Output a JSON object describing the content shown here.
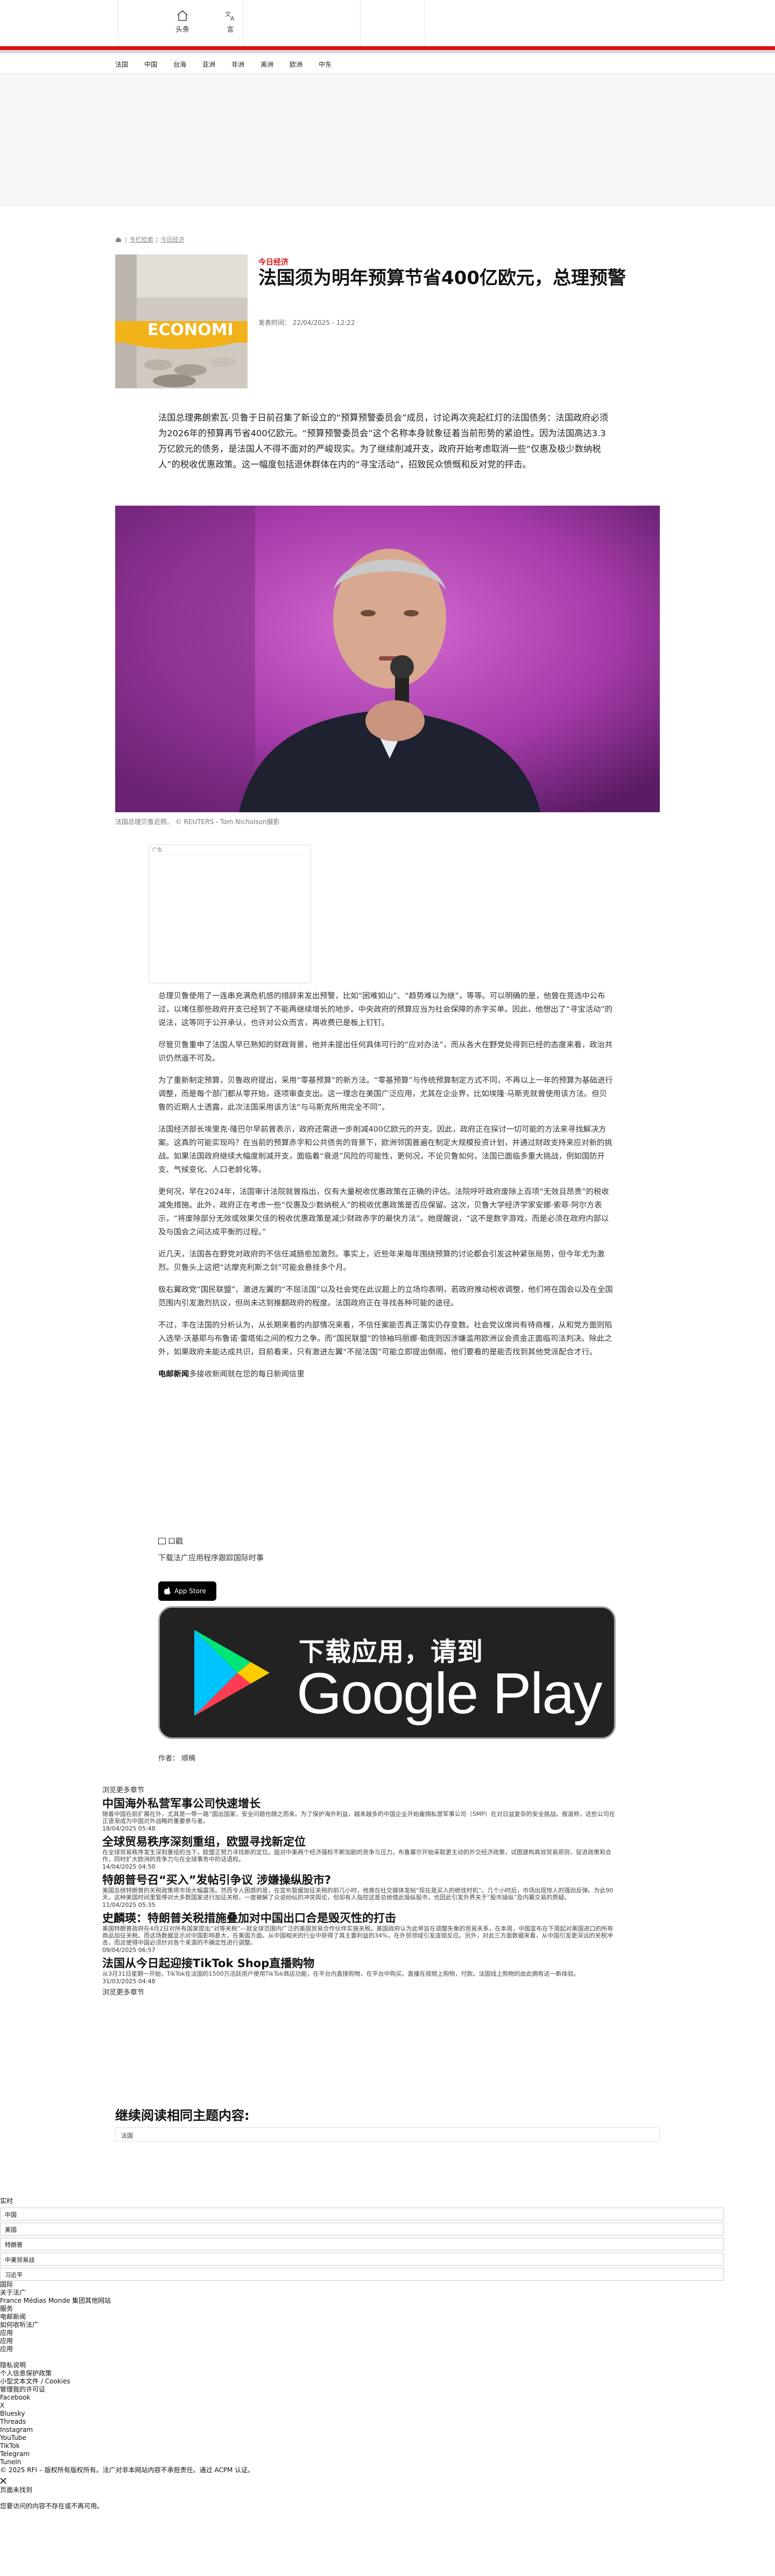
{
  "header": {
    "tabs": [
      {
        "label": "头条",
        "icon": "home-icon"
      },
      {
        "label": "言",
        "icon": "translate-icon"
      }
    ]
  },
  "nav": {
    "items": [
      "法国",
      "中国",
      "台海",
      "亚洲",
      "非洲",
      "美洲",
      "欧洲",
      "中东"
    ]
  },
  "breadcrumb": {
    "items": [
      "专栏检索",
      "今日经济"
    ]
  },
  "article": {
    "kicker": "今日经济",
    "title": "法国须为明年预算节省400亿欧元，总理预警",
    "date": "发表时间： 22/04/2025 - 12:22",
    "thumb_text": "ECONOMI",
    "lead": "法国总理弗朗索瓦·贝鲁于日前召集了新设立的“预算预警委员会”成员，讨论再次亮起红灯的法国债务：法国政府必须为2026年的预算再节省400亿欧元。“预算预警委员会”这个名称本身就象征着当前形势的紧迫性。因为法国高达3.3万亿欧元的债务，是法国人不得不面对的严峻现实。为了继续削减开支，政府开始考虑取消一些“仅惠及极少数纳税人”的税收优惠政策。这一幅度包括退休群体在内的“寻宝活动”，招致民众愤慨和反对党的抨击。",
    "caption": "法国总理贝鲁近照。 © REUTERS - Tom Nicholson摄影",
    "ad_label": "广告",
    "paragraphs": [
      "总理贝鲁使用了一连串充满危机感的措辞来发出预警，比如“困难如山”、“趋势难以为继”，等等。可以明确的是，他曾在竞选中公布过，以堵住那些政府开支已经到了不能再继续增长的地步。中央政府的预算应当为社会保障的赤字买单。因此，他想出了“寻宝活动”的说法，这等同于公开承认，也许对公众而言，再收费已是板上钉钉。",
      "尽管贝鲁重申了法国人早已熟知的财政背景，他并未提出任何具体可行的“应对办法”，而从各大在野党处得到已经的态度来看，政治共识仍然遥不可及。",
      "为了重新制定预算，贝鲁政府提出，采用“零基预算”的新方法。“零基预算”与传统预算制定方式不同，不再以上一年的预算为基础进行调整，而是每个部门都从零开始，逐项审查支出。这一理念在美国广泛应用，尤其在企业界，比如埃隆·马斯克就曾使用该方法。但贝鲁的近期人士透露，此次法国采用该方法“与马斯克所用完全不同”。",
      "法国经济部长埃里克·隆巴尔早前曾表示，政府还需进一步削减400亿欧元的开支。因此，政府正在探讨一切可能的方法来寻找解决方案。这真的可能实现吗？在当前的预算赤字和公共债务的背景下，欧洲邻国普遍在制定大规模投资计划，并通过财政支持来应对新的挑战。如果法国政府继续大幅度削减开支，面临着“衰退”风险的可能性，更何况，不论贝鲁如何，法国已面临多重大挑战，例如国防开支、气候变化、人口老龄化等。",
      "更何况，早在2024年，法国审计法院就曾指出，仅有大量税收优惠政策在正确的评估。法院呼吁政府废除上百项“无效且昂贵”的税收减免措施。此外，政府正在考虑一些“仅惠及少数纳税人”的税收优惠政策是否应保留。这次，贝鲁大学经济学家安娜·索菲·阿尔方表示，“将废除部分无效或效果欠佳的税收优惠政策是减少财政赤字的最快方法”。她提醒说，“这不是数字游戏，而是必须在政府内部以及与国会之间达成平衡的过程。”",
      "近几天，法国各在野党对政府的不信任减肠愈加激烈。事实上，近些年来每年围绕预算的讨论都会引发这种紧张局势，但今年尤为激烈。贝鲁头上这把“达摩克利斯之剑”可能会悬挂多个月。",
      "极右翼政党“国民联盟”、激进左翼的“不屈法国”以及社会党在此议题上的立场均表明，若政府推动税收调整，他们将在国会以及在全国范围内引发激烈抗议，但尚未达到推翻政府的程度。法国政府正在寻找各种可能的途径。",
      "不过，丰在法国的分析认为，从长期来看的内部情况来看，不信任案能否真正落实仍存变数。社会党议席尚有待商榷，从和党方面则陷入选举·沃基耶与布鲁诺·雷塔佑之间的权力之争。而“国民联盟”的领袖玛丽娜·勒庞则因涉嫌滥用欧洲议会资金正面临司法判决。除此之外，如果政府未能达成共识，目前看来，只有激进左翼“不屈法国”可能立即提出倒阁，他们要看的是能否找到其他党派配合才行。"
    ],
    "newsletter_bold": "电邮新闻",
    "newsletter_text": "多接收新闻就在您的每日新闻信里",
    "share_label": "口戳",
    "download_line": "下载法广应用程序跟踪国际时事",
    "appstore": "App Store",
    "gplay_line1": "下载应用，请到",
    "gplay_line2": "Google Play",
    "author": "作者： 顺楠"
  },
  "related": {
    "header": "浏览更多章节",
    "items": [
      {
        "title": "中国海外私营军事公司快速增长",
        "desc": "随着中国在前扩展在外，尤其是一带一路“国出国家，安全问题也随之而来。为了保护海外利益，越来越多的中国企业开始雇佣私营军事公司（SMP）在对日益复杂的安全挑战。报道称，这些公司在正逐渐成为中国对外战略的重要参与者。",
        "date": "18/04/2025 05:48"
      },
      {
        "title": "全球贸易秩序深刻重组，欧盟寻找新定位",
        "desc": "在全球贸易秩序发生深刻重组的当下，欧盟正努力寻找新的定位。面对中美两个经济强权不断加剧的竞争与压力，布鲁塞尔开始采取更主动的外交经济政策，试图建构高效贸易原则，促进政策和合作，同时扩大欧洲的竞争力与在全球事务中的话语权。",
        "date": "14/04/2025 04:50"
      },
      {
        "title": "特朗普号召“买入”发帖引争议 涉嫌操纵股市?",
        "desc": "美国总统特朗普的关税政策将市场大幅震荡。然而令人困惑的是，在宣布暂缓加征关税的前几小时，他曾在社交媒体发帖“现在是买入的绝佳时机”。几个小时后，市场出现惊人的强劲反弹。为此90天，这种美国时间里暂停对大多数国家进行加征关税，一度被解了众说纷纭的冲突舆论，但却有人指控这是总统借此操纵股市，也因此引发外界关于“股市操纵”及内幕交易的质疑。",
        "date": "11/04/2025 05:35"
      },
      {
        "title": "史麟瑛：特朗普关税措施叠加对中国出口合是毁灭性的打击",
        "desc": "美国特朗普政府在4月2日对所有国家提出“对等关税”—就全球范围内广泛的美国贸易合作伙伴实施关税。美国政府认为此举旨在调整失衡的贸易关系，在本周，中国宣布在下周起对美国进口的所有商品加征关税。而这场数据显示对中国影响甚大，在美国方面，从中国相关的行业中获得了其主要利益的34%，在外贸领域引发连锁反应。另外，对此三方面数据来看，从中国引发更深远的关税冲击，而这使得中国必须针对各个来源的不确定性进行调整。",
        "date": "09/04/2025 06:57"
      },
      {
        "title": "法国从今日起迎接TikTok Shop直播购物",
        "desc": "从3月31日星期一开始，TikTok在法国的1500万活跃用户使用TikTok商店功能，在平台内直接购物，在平台中购买。直播在视频上购物，付款。法国线上购物的由此拥有这一新体验。",
        "date": "31/03/2025 04:48"
      }
    ],
    "more": "浏览更多章节"
  },
  "continue": {
    "title": "继续阅读相同主题内容:",
    "tag": "法国"
  },
  "footer": {
    "search_label": "实时",
    "fields": [
      "中国",
      "美国",
      "特朗普",
      "中美贸易战",
      "习近平"
    ],
    "links": [
      "国际",
      "关于法广",
      "France Médias Monde 集团其他网站",
      "服务",
      "电邮新闻",
      "如何收听法广",
      "应用",
      "应用",
      "应用"
    ],
    "legal": [
      "隐私说明",
      "个人信息保护政策",
      "小型文本文件 / Cookies",
      "管理我的许可证"
    ],
    "social": [
      "Facebook",
      "X",
      "Bluesky",
      "Threads",
      "Instagram",
      "YouTube",
      "TikTok",
      "Telegram",
      "TuneIn"
    ],
    "copyright": "© 2025 RFI – 版权所有版权所有。法广对非本网站内容不承担责任。通过 ACPM 认证。",
    "close_label": "页面未找到",
    "note": "您要访问的内容不存在或不再可用。"
  },
  "colors": {
    "accent": "#dd1111",
    "title": "#111111",
    "gplay_bg": "#222222"
  }
}
